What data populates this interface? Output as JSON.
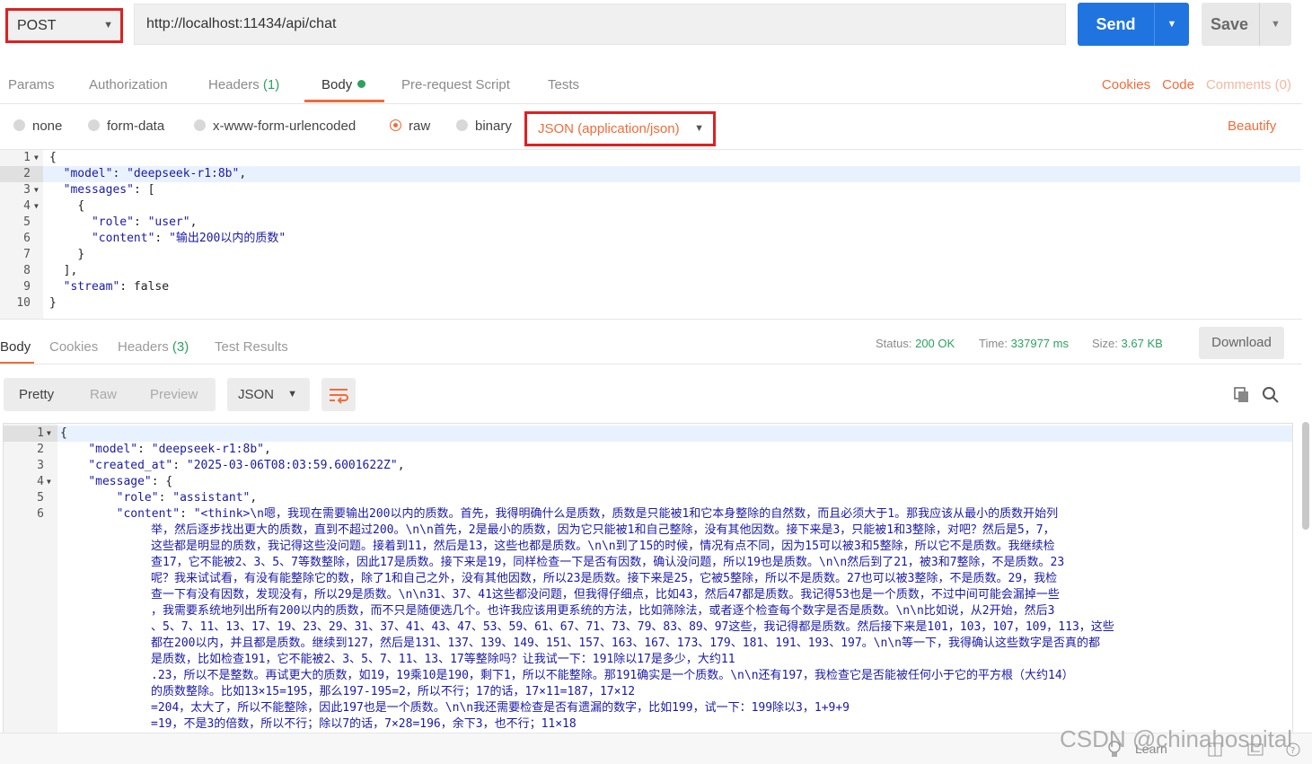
{
  "request": {
    "method": "POST",
    "url": "http://localhost:11434/api/chat",
    "send_label": "Send",
    "save_label": "Save"
  },
  "request_tabs": {
    "params": "Params",
    "authorization": "Authorization",
    "headers": "Headers",
    "headers_count": "(1)",
    "body": "Body",
    "prerequest": "Pre-request Script",
    "tests": "Tests"
  },
  "request_links": {
    "cookies": "Cookies",
    "code": "Code",
    "comments": "Comments (0)"
  },
  "body_types": {
    "none": "none",
    "form_data": "form-data",
    "urlencoded": "x-www-form-urlencoded",
    "raw": "raw",
    "binary": "binary",
    "content_type": "JSON (application/json)",
    "beautify": "Beautify"
  },
  "request_body": {
    "line_numbers": [
      "1",
      "2",
      "3",
      "4",
      "5",
      "6",
      "7",
      "8",
      "9",
      "10"
    ],
    "l1": "{",
    "l2_key": "\"model\"",
    "l2_val": "\"deepseek-r1:8b\"",
    "l3_key": "\"messages\"",
    "l3_rest": ": [",
    "l4": "{",
    "l5_key": "\"role\"",
    "l5_val": "\"user\"",
    "l6_key": "\"content\"",
    "l6_val": "\"输出200以内的质数\"",
    "l7": "}",
    "l8": "],",
    "l9_key": "\"stream\"",
    "l9_rest": ": false",
    "l10": "}"
  },
  "response_tabs": {
    "body": "Body",
    "cookies": "Cookies",
    "headers": "Headers",
    "headers_count": "(3)",
    "test_results": "Test Results"
  },
  "response_status": {
    "status_label": "Status:",
    "status_value": "200 OK",
    "time_label": "Time:",
    "time_value": "337977 ms",
    "size_label": "Size:",
    "size_value": "3.67 KB",
    "download": "Download"
  },
  "view_modes": {
    "pretty": "Pretty",
    "raw": "Raw",
    "preview": "Preview",
    "format": "JSON"
  },
  "response_body": {
    "line_numbers": [
      "1",
      "2",
      "3",
      "4",
      "5",
      "6"
    ],
    "l1": "{",
    "l2_key": "\"model\"",
    "l2_val": "\"deepseek-r1:8b\"",
    "l3_key": "\"created_at\"",
    "l3_val": "\"2025-03-06T08:03:59.6001622Z\"",
    "l4_key": "\"message\"",
    "l4_rest": ": {",
    "l5_key": "\"role\"",
    "l5_val": "\"assistant\"",
    "l6_key": "\"content\"",
    "l6_first": "\"<think>\\n嗯，我现在需要输出200以内的质数。首先，我得明确什么是质数，质数是只能被1和它本身整除的自然数，而且必须大于1。那我应该从最小的质数开始列",
    "content_lines": [
      "举，然后逐步找出更大的质数，直到不超过200。\\n\\n首先，2是最小的质数，因为它只能被1和自己整除，没有其他因数。接下来是3，只能被1和3整除，对吧？然后是5，7，",
      "这些都是明显的质数，我记得这些没问题。接着到11，然后是13，这些也都是质数。\\n\\n到了15的时候，情况有点不同，因为15可以被3和5整除，所以它不是质数。我继续检",
      "查17，它不能被2、3、5、7等数整除，因此17是质数。接下来是19，同样检查一下是否有因数，确认没问题，所以19也是质数。\\n\\n然后到了21，被3和7整除，不是质数。23",
      "呢？我来试试看，有没有能整除它的数，除了1和自己之外，没有其他因数，所以23是质数。接下来是25，它被5整除，所以不是质数。27也可以被3整除，不是质数。29，我检",
      "查一下有没有因数，发现没有，所以29是质数。\\n\\n31、37、41这些都没问题，但我得仔细点，比如43，然后47都是质数。我记得53也是一个质数，不过中间可能会漏掉一些",
      "，我需要系统地列出所有200以内的质数，而不只是随便选几个。也许我应该用更系统的方法，比如筛除法，或者逐个检查每个数字是否是质数。\\n\\n比如说，从2开始，然后3",
      "、5、7、11、13、17、19、23、29、31、37、41、43、47、53、59、61、67、71、73、79、83、89、97这些，我记得都是质数。然后接下来是101，103，107，109，113，这些",
      "都在200以内，并且都是质数。继续到127，然后是131、137、139、149、151、157、163、167、173、179、181、191、193、197。\\n\\n等一下，我得确认这些数字是否真的都",
      "是质数，比如检查191，它不能被2、3、5、7、11、13、17等整除吗？让我试一下：191除以17是多少，大约11",
      ".23，所以不是整数。再试更大的质数，如19，19乘10是190，剩下1，所以不能整除。那191确实是一个质数。\\n\\n还有197，我检查它是否能被任何小于它的平方根（大约14）",
      "的质数整除。比如13×15=195，那么197-195=2，所以不行；17的话，17×11=187，17×12",
      "=204，太大了，所以不能整除，因此197也是一个质数。\\n\\n我还需要检查是否有遗漏的数字，比如199，试一下：199除以3，1+9+9",
      "=19，不是3的倍数，所以不行；除以7的话，7×28=196，余下3，也不行；11×18"
    ]
  },
  "footer": {
    "learn": "Learn",
    "watermark": "CSDN @chinahospital"
  },
  "colors": {
    "accent": "#f26b3a",
    "send": "#1f74e0",
    "ok": "#2ca25f",
    "json_string": "#1a1aa6"
  }
}
